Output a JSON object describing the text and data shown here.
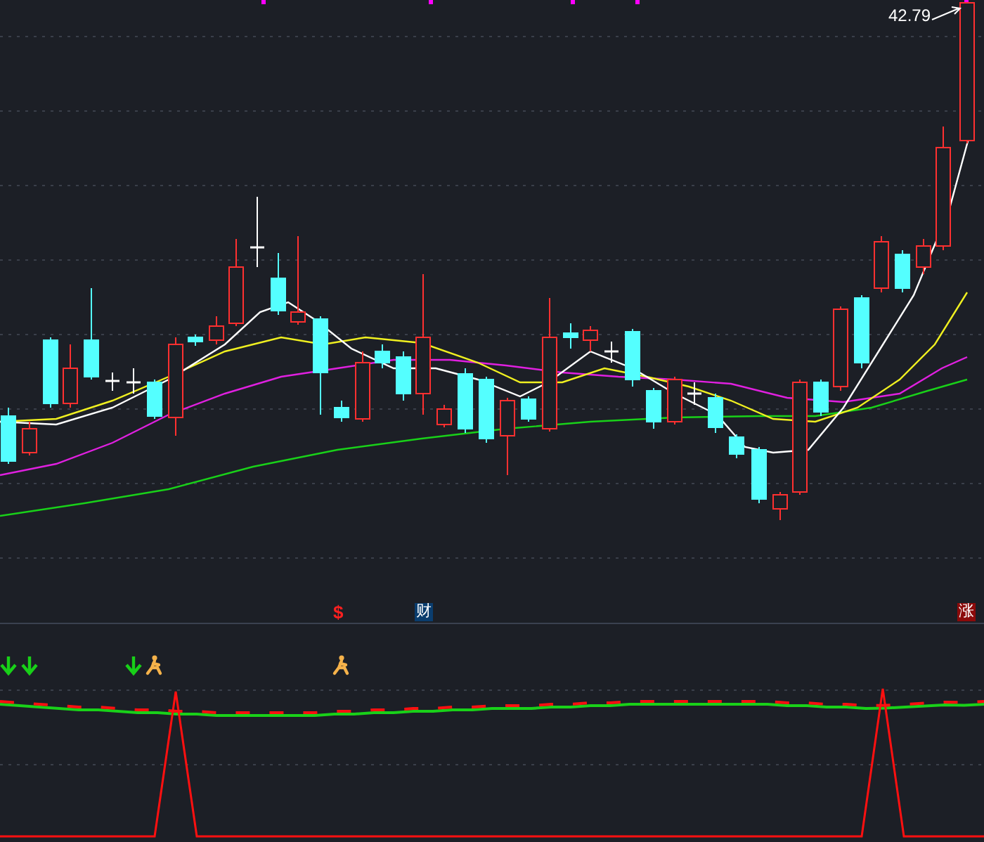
{
  "price_chart": {
    "high_label": "42.79"
  },
  "event_markers": [
    {
      "kind": "dollar",
      "text": "$"
    },
    {
      "kind": "finance",
      "text": "财"
    },
    {
      "kind": "rise",
      "text": "涨"
    }
  ]
}
